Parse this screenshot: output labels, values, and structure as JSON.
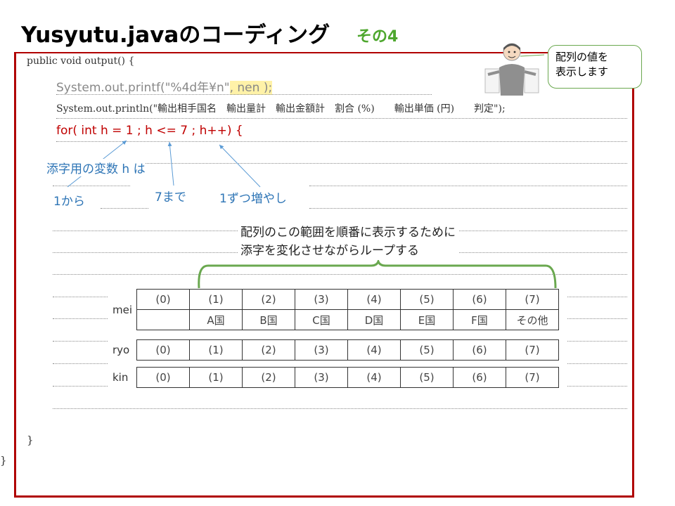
{
  "slide": {
    "title": "Yusyutu.javaのコーディング",
    "subtitle": "その4"
  },
  "bubble": {
    "line1": "配列の値を",
    "line2": "表示します"
  },
  "code": {
    "method_open": "public void output() {",
    "printf_prefix": "System.out.printf(\"%4d年¥n\"",
    "printf_arg": ", nen );",
    "println": "System.out.println(\"輸出相手国名　輸出量計　輸出金額計　割合 (%)　　輸出単価 (円)　　判定\");",
    "for_loop": "for( int h = 1 ; h <= 7 ;  h++) {",
    "close_inner": "}",
    "close_outer": "}"
  },
  "annotations": {
    "subscript_var": "添字用の変数 h は",
    "from": "1から",
    "to": "7まで",
    "step": "1ずつ増やし",
    "callout_line1": "配列のこの範囲を順番に表示するために",
    "callout_line2": "添字を変化させながらループする"
  },
  "arrays": {
    "mei": {
      "label": "mei",
      "indices": [
        "(0)",
        "(1)",
        "(2)",
        "(3)",
        "(4)",
        "(5)",
        "(6)",
        "(7)"
      ],
      "values": [
        "",
        "A国",
        "B国",
        "C国",
        "D国",
        "E国",
        "F国",
        "その他"
      ]
    },
    "ryo": {
      "label": "ryo",
      "indices": [
        "(0)",
        "(1)",
        "(2)",
        "(3)",
        "(4)",
        "(5)",
        "(6)",
        "(7)"
      ]
    },
    "kin": {
      "label": "kin",
      "indices": [
        "(0)",
        "(1)",
        "(2)",
        "(3)",
        "(4)",
        "(5)",
        "(6)",
        "(7)"
      ]
    }
  },
  "colors": {
    "title_accent": "#4ea72e",
    "frame": "#b00000",
    "loop_code": "#c00000",
    "annotation": "#2e75b6",
    "brace": "#6aa84f",
    "highlight": "#fff2a8"
  }
}
